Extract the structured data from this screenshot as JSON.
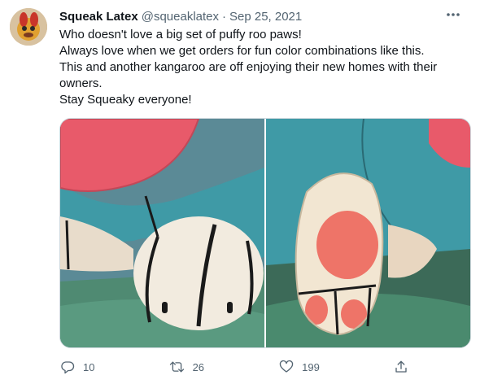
{
  "tweet": {
    "author_name": "Squeak Latex",
    "handle": "@squeaklatex",
    "separator": "·",
    "date": "Sep 25, 2021",
    "lines": [
      "Who doesn't love a big set of puffy roo paws!",
      "Always love when we get orders for fun color combinations like this.",
      "This and another kangaroo are off enjoying their new homes with their",
      "owners.",
      "Stay Squeaky everyone!"
    ]
  },
  "actions": {
    "reply_count": "10",
    "retweet_count": "26",
    "like_count": "199"
  },
  "icons": {
    "more": "more-icon",
    "reply": "reply-icon",
    "retweet": "retweet-icon",
    "like": "heart-icon",
    "share": "share-icon"
  },
  "colors": {
    "text": "#0f1419",
    "secondary": "#536471",
    "border": "#cfd9de"
  }
}
